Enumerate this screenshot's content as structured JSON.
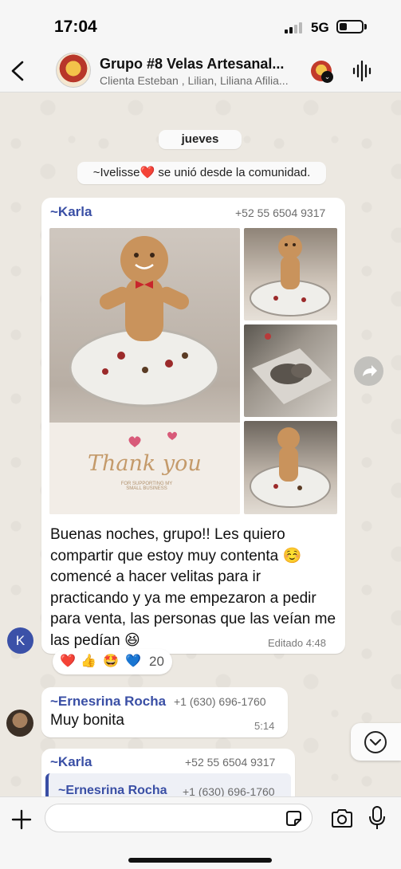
{
  "status_bar": {
    "time": "17:04",
    "network": "5G"
  },
  "header": {
    "title": "Grupo #8 Velas Artesanal...",
    "subtitle": "Clienta Esteban , Lilian, Liliana Afilia..."
  },
  "system": {
    "day_label": "jueves",
    "join_notice": "~Ivelisse❤️ se unió desde la comunidad."
  },
  "messages": [
    {
      "sender": "~Karla",
      "phone": "+52 55 6504 9317",
      "card_text": "Thank you",
      "card_subtext": "FOR SUPPORTING MY SMALL BUSINESS",
      "text": "Buenas noches, grupo!! Les quiero compartir que estoy muy contenta ☺️ comencé a hacer velitas para ir practicando y ya me empezaron a pedir para venta, las personas que las veían me las pedían 😆",
      "time": "Editado 4:48",
      "avatar_letter": "K",
      "reactions": {
        "emojis": [
          "❤️",
          "👍",
          "🤩",
          "💙"
        ],
        "count": "20"
      }
    },
    {
      "sender": "~Ernesrina Rocha",
      "phone": "+1 (630) 696-1760",
      "text": "Muy bonita",
      "time": "5:14"
    },
    {
      "sender": "~Karla",
      "phone": "+52 55 6504 9317",
      "quoted_sender": "~Ernesrina Rocha",
      "quoted_phone": "+1 (630) 696-1760"
    }
  ],
  "input": {
    "placeholder": ""
  },
  "icons": {
    "back": "chevron-left-icon",
    "voice": "waveform-icon",
    "forward": "forward-arrow-icon",
    "scroll": "chevron-down-icon",
    "plus": "plus-icon",
    "sticker": "sticker-icon",
    "camera": "camera-icon",
    "mic": "microphone-icon"
  },
  "colors": {
    "sender_name": "#3a4fa5",
    "avatar_k": "#3b51a8",
    "bubble": "#ffffff"
  }
}
